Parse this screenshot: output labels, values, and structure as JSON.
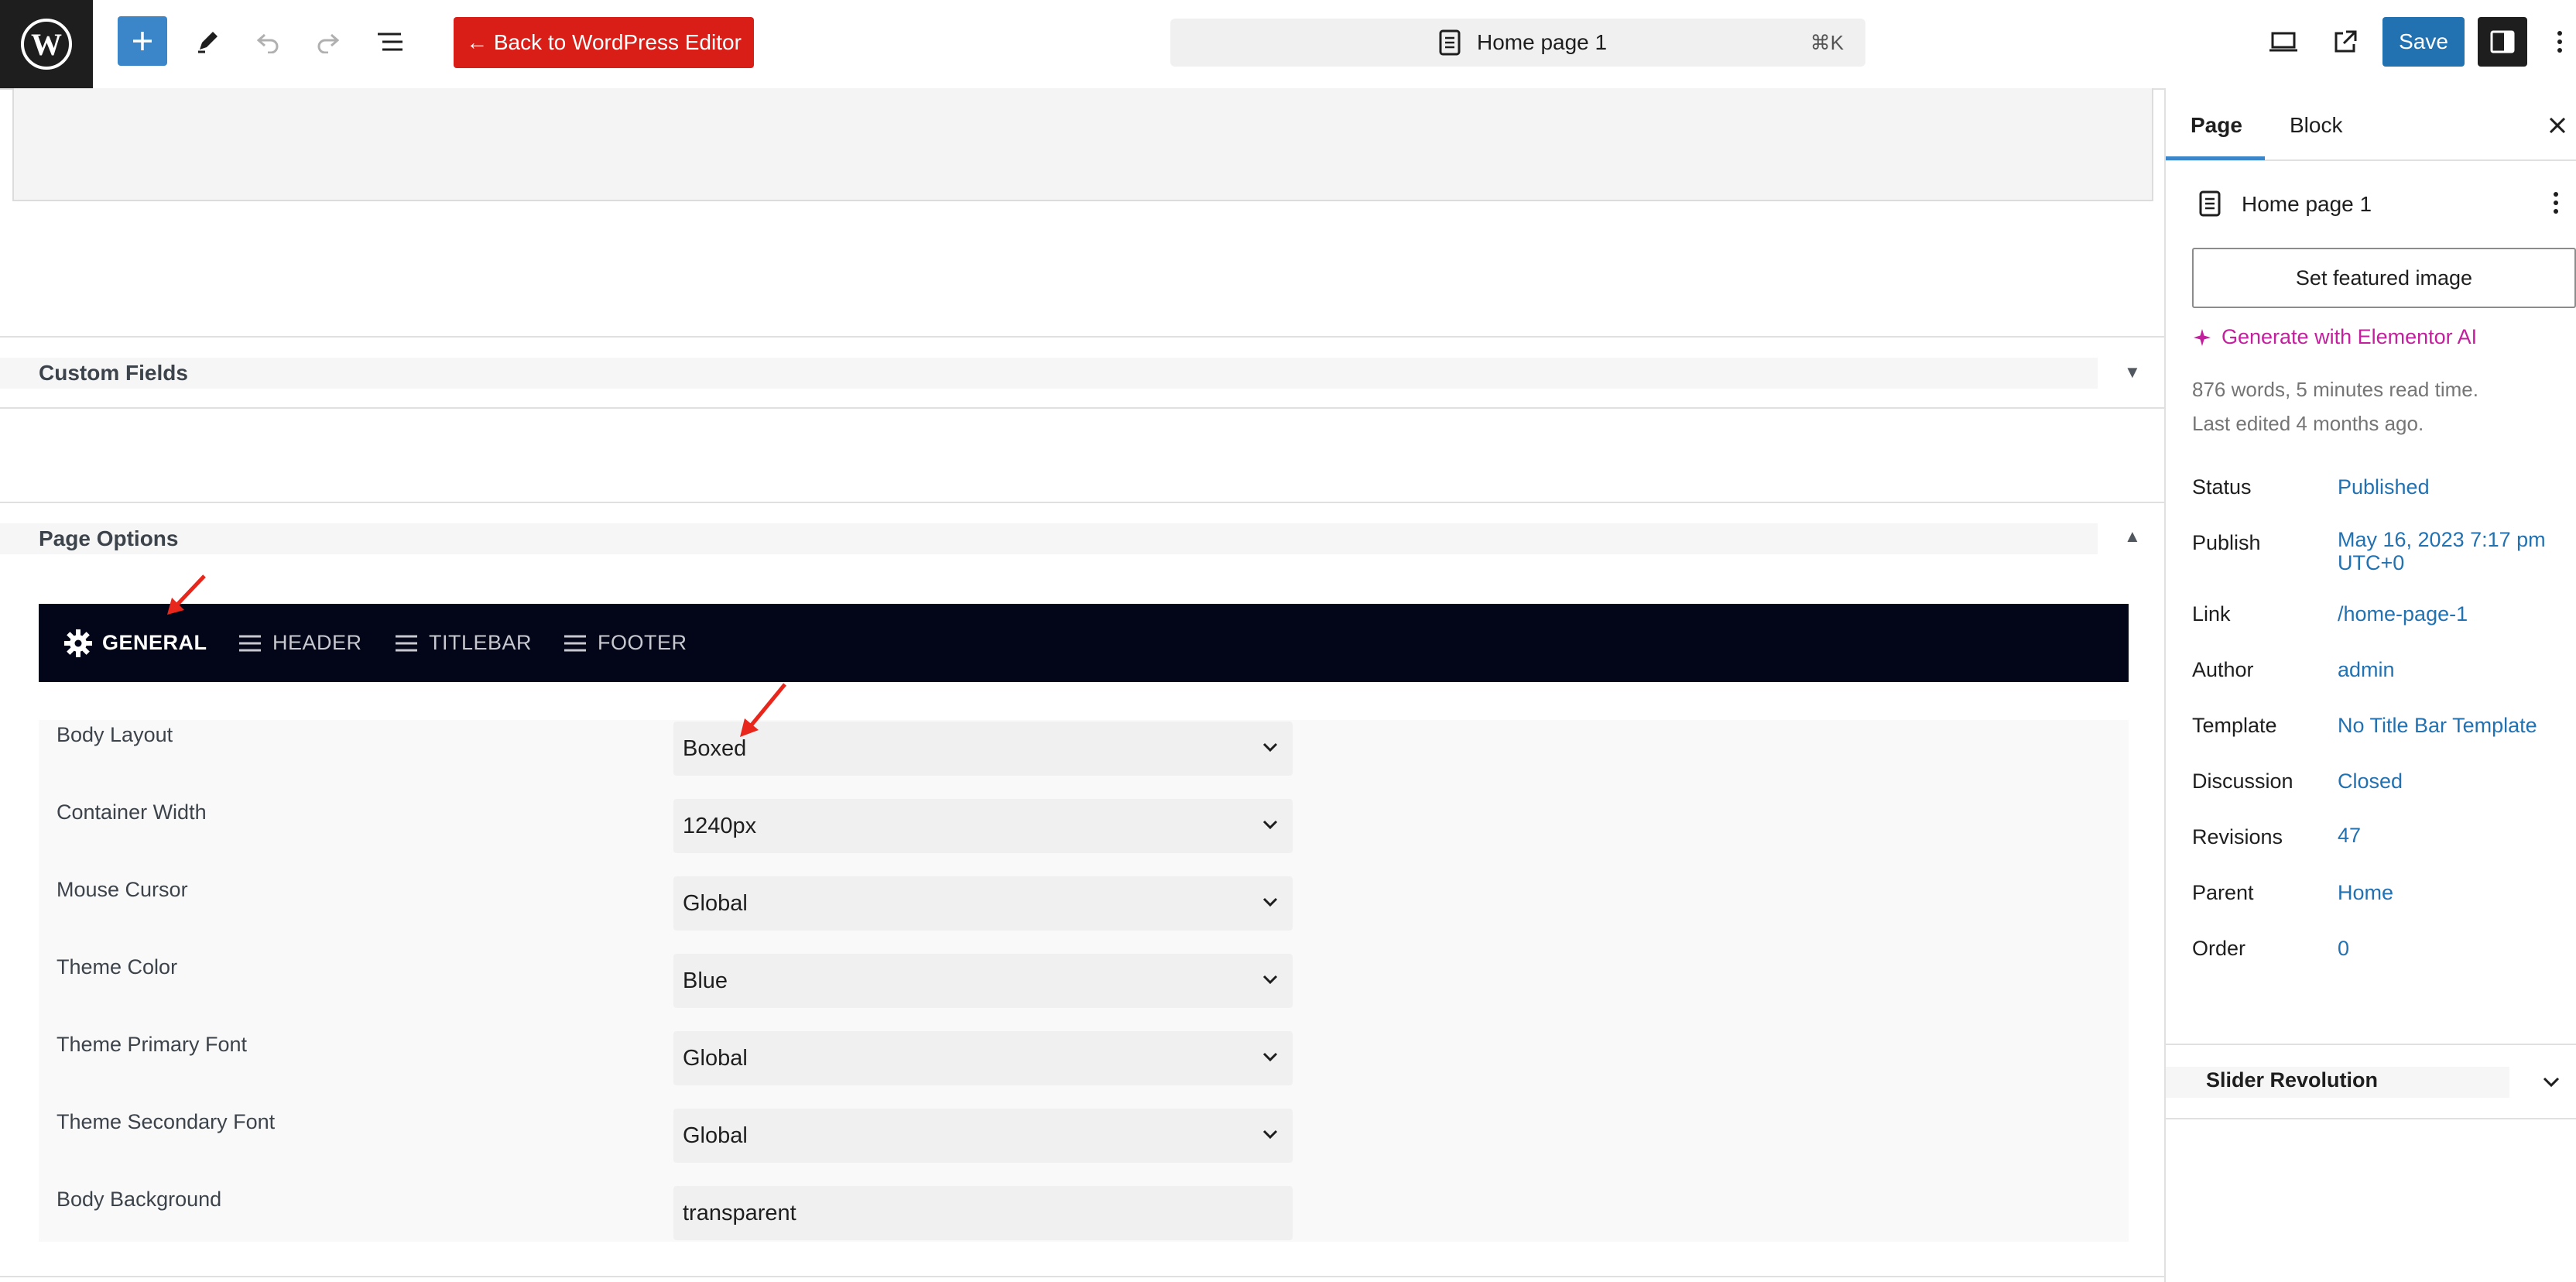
{
  "topbar": {
    "back_label": "← Back to WordPress Editor",
    "doc_title": "Home page 1",
    "shortcut": "⌘K",
    "save_label": "Save"
  },
  "metaboxes": {
    "custom_fields": "Custom Fields",
    "page_options": "Page Options"
  },
  "page_options": {
    "tabs": [
      {
        "label": "GENERAL",
        "icon": "gear-icon",
        "active": true
      },
      {
        "label": "HEADER",
        "icon": "menu-lines-icon",
        "active": false
      },
      {
        "label": "TITLEBAR",
        "icon": "menu-lines-icon",
        "active": false
      },
      {
        "label": "FOOTER",
        "icon": "menu-lines-icon",
        "active": false
      }
    ],
    "fields": [
      {
        "label": "Body Layout",
        "value": "Boxed",
        "type": "select"
      },
      {
        "label": "Container Width",
        "value": "1240px",
        "type": "select"
      },
      {
        "label": "Mouse Cursor",
        "value": "Global",
        "type": "select"
      },
      {
        "label": "Theme Color",
        "value": "Blue",
        "type": "select"
      },
      {
        "label": "Theme Primary Font",
        "value": "Global",
        "type": "select"
      },
      {
        "label": "Theme Secondary Font",
        "value": "Global",
        "type": "select"
      },
      {
        "label": "Body Background",
        "value": "transparent",
        "type": "text"
      }
    ]
  },
  "sidebar": {
    "tabs": [
      "Page",
      "Block"
    ],
    "doc_title": "Home page 1",
    "featured_label": "Set featured image",
    "ai_label": "Generate with Elementor AI",
    "stats": "876 words, 5 minutes read time.",
    "last_edited": "Last edited 4 months ago.",
    "rows": [
      {
        "label": "Status",
        "value": "Published"
      },
      {
        "label": "Publish",
        "value": "May 16, 2023 7:17 pm",
        "value2": "UTC+0"
      },
      {
        "label": "Link",
        "value": "/home-page-1"
      },
      {
        "label": "Author",
        "value": "admin"
      },
      {
        "label": "Template",
        "value": "No Title Bar Template"
      },
      {
        "label": "Discussion",
        "value": "Closed"
      },
      {
        "label": "Revisions",
        "value": "47"
      },
      {
        "label": "Parent",
        "value": "Home"
      },
      {
        "label": "Order",
        "value": "0"
      }
    ],
    "slider_title": "Slider Revolution"
  },
  "colors": {
    "accent": "#2271b1",
    "back_button": "#d91e18",
    "ai_link": "#c3209d",
    "nav_bg": "#030618",
    "annotation_arrow": "#e8261c"
  }
}
